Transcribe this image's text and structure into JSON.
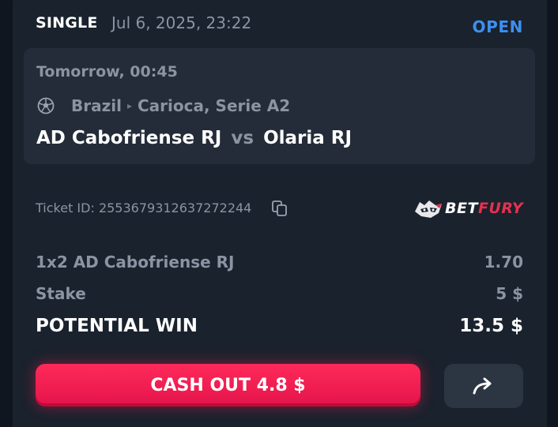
{
  "header": {
    "bet_type": "SINGLE",
    "date": "Jul 6, 2025, 23:22",
    "status": "OPEN"
  },
  "event": {
    "time": "Tomorrow, 00:45",
    "sport_icon": "soccer-ball-icon",
    "country": "Brazil",
    "league": "Carioca, Serie A2",
    "home_team": "AD Cabofriense RJ",
    "vs": "vs",
    "away_team": "Olaria RJ"
  },
  "ticket": {
    "label": "Ticket ID: 2553679312637272244",
    "copy_icon": "copy-icon",
    "brand_bet": "BET",
    "brand_fury": "FURY"
  },
  "lines": {
    "selection_label": "1x2 AD Cabofriense RJ",
    "selection_odds": "1.70",
    "stake_label": "Stake",
    "stake_value": "5 $",
    "win_label": "POTENTIAL WIN",
    "win_value": "13.5 $"
  },
  "actions": {
    "cashout_label": "CASH OUT 4.8 $",
    "share_icon": "share-arrow-icon"
  },
  "colors": {
    "background": "#0f1620",
    "card": "#1a222d",
    "event_card": "#232c38",
    "accent_open": "#3d8ff0",
    "cashout": "#ff2a5a",
    "brand_red": "#e6304f"
  }
}
